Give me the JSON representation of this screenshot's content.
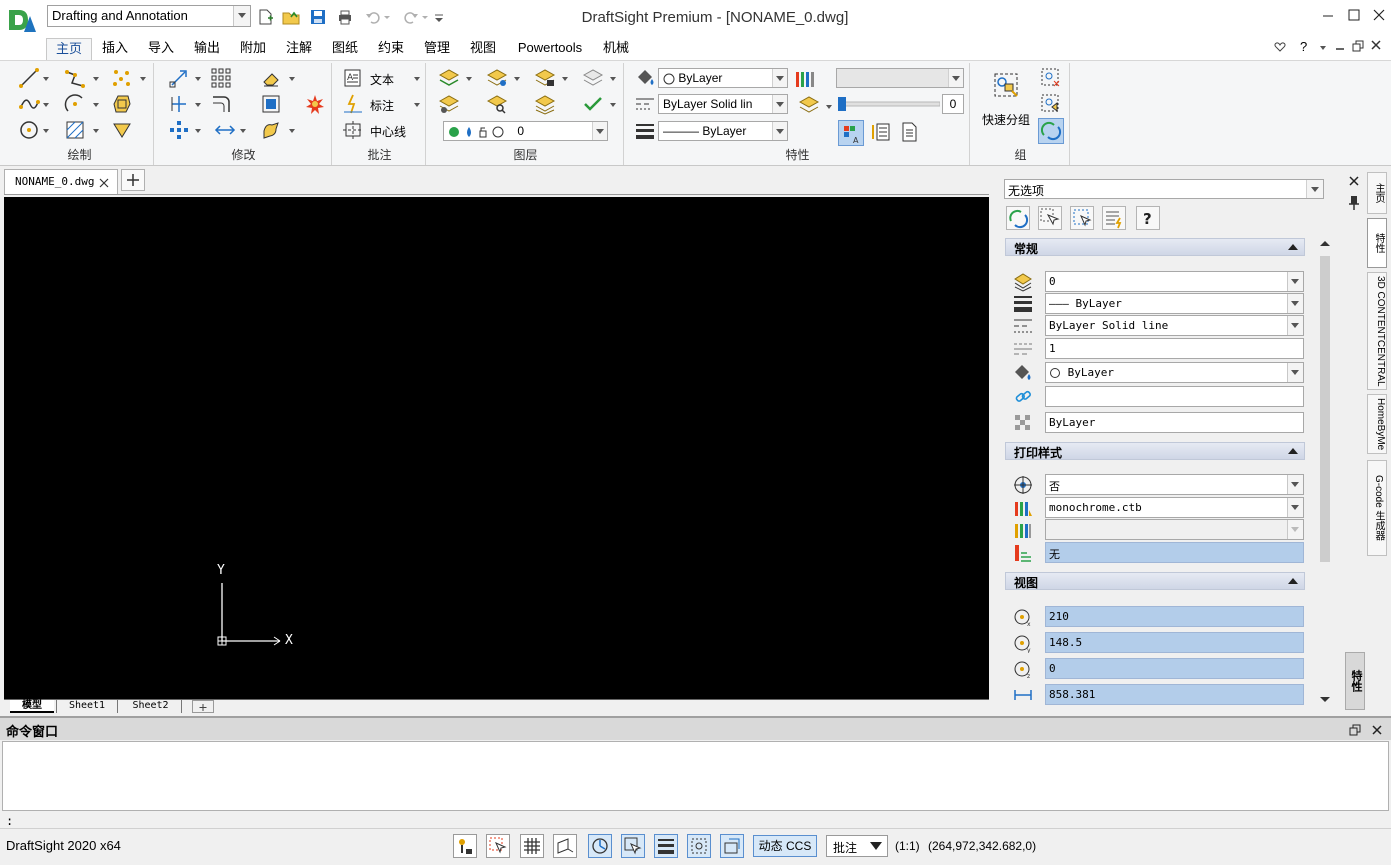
{
  "titlebar": {
    "workspace": "Drafting and Annotation",
    "window_title": "DraftSight Premium - [NONAME_0.dwg]"
  },
  "ribbon_tabs": [
    "主页",
    "插入",
    "导入",
    "输出",
    "附加",
    "注解",
    "图纸",
    "约束",
    "管理",
    "视图",
    "Powertools",
    "机械"
  ],
  "ribbon": {
    "groups": {
      "draw": "绘制",
      "modify": "修改",
      "annotate": "批注",
      "layers": "图层",
      "properties": "特性",
      "group": "组"
    },
    "annotate_items": {
      "text": "文本",
      "dimension": "标注",
      "centerline": "中心线"
    },
    "layer_combo": "0",
    "color_combo": "ByLayer",
    "linestyle_combo": "ByLayer     Solid lin",
    "lineweight_combo": "——— ByLayer",
    "transparency_value": "0",
    "quick_group": "快速分组"
  },
  "document": {
    "tab": "NONAME_0.dwg"
  },
  "sheets": [
    "模型",
    "Sheet1",
    "Sheet2"
  ],
  "ucs": {
    "x": "X",
    "y": "Y"
  },
  "panel": {
    "selection": "无选项",
    "general": {
      "title": "常规",
      "layer": "0",
      "lineweight": "——— ByLayer",
      "linestyle": "ByLayer     Solid line",
      "linescale": "1",
      "color": "ByLayer",
      "hyperlink": "",
      "transparency": "ByLayer"
    },
    "print": {
      "title": "打印样式",
      "print_style": "否",
      "table": "monochrome.ctb",
      "attached": "",
      "none": "无"
    },
    "view": {
      "title": "视图",
      "center_x": "210",
      "center_y": "148.5",
      "center_z": "0",
      "width": "858.381"
    }
  },
  "right_tabs": [
    "主页",
    "特性",
    "3D CONTENTCENTRAL",
    "HomeByMe",
    "G-code 生成器"
  ],
  "right_tab_bottom": "特性",
  "command": {
    "title": "命令窗口",
    "prompt": ":"
  },
  "statusbar": {
    "app": "DraftSight 2020 x64",
    "dynamic_ccs": "动态 CCS",
    "annotation": "批注",
    "scale": "(1:1)",
    "coords": "(264,972,342.682,0)"
  }
}
